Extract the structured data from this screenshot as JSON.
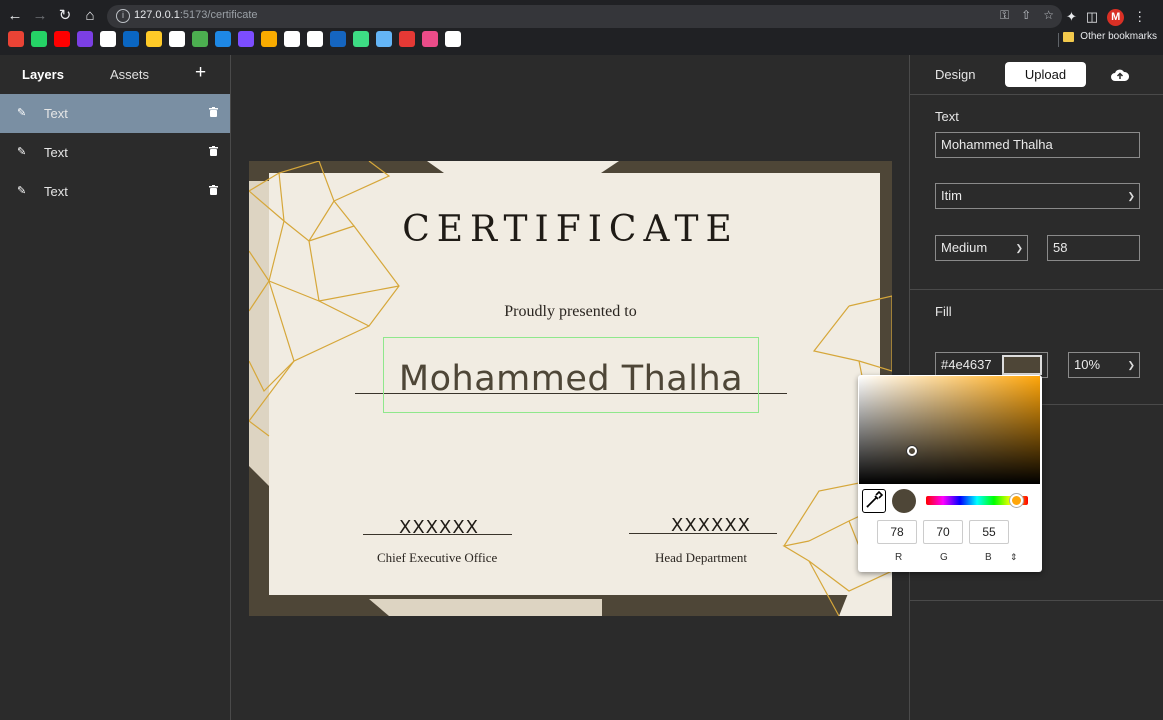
{
  "browser": {
    "url_host": "127.0.0.1",
    "url_rest": ":5173/certificate",
    "other_bookmarks": "Other bookmarks",
    "profile_initial": "M",
    "bookmark_colors": [
      "#ea4335",
      "#25d366",
      "#ff0000",
      "#7b3fe4",
      "#ffffff",
      "#0a66c2",
      "#ffca28",
      "#ffffff",
      "#4caf50",
      "#1e88e5",
      "#7c4dff",
      "#f9ab00",
      "#ffffff",
      "#ffffff",
      "#1565c0",
      "#3ddc84",
      "#64b5f6",
      "#e53935",
      "#ea4c89",
      "#ffffff"
    ]
  },
  "left_panel": {
    "tabs": {
      "layers": "Layers",
      "assets": "Assets",
      "add": "+"
    },
    "layers": [
      {
        "label": "Text",
        "active": true
      },
      {
        "label": "Text",
        "active": false
      },
      {
        "label": "Text",
        "active": false
      }
    ]
  },
  "certificate": {
    "title": "CERTIFICATE",
    "subtitle": "Proudly presented to",
    "name": "Mohammed Thalha",
    "sig_left": {
      "placeholder": "XXXXXX",
      "role": "Chief Executive Office"
    },
    "sig_right": {
      "placeholder": "XXXXXX",
      "role": "Head Department"
    },
    "colors": {
      "paper": "#f1ece2",
      "frame": "#4e4637",
      "accent": "#d6a73a",
      "panel": "#ddd4c2"
    }
  },
  "right_panel": {
    "tabs": {
      "design": "Design",
      "upload": "Upload"
    },
    "text_section": {
      "label": "Text",
      "value": "Mohammed Thalha",
      "font": "Itim",
      "weight": "Medium",
      "size": "58"
    },
    "fill_section": {
      "label": "Fill",
      "hex": "#4e4637",
      "opacity": "10%"
    }
  },
  "color_picker": {
    "r": "78",
    "g": "70",
    "b": "55",
    "labels": {
      "r": "R",
      "g": "G",
      "b": "B"
    },
    "current_color": "#4e4637"
  }
}
